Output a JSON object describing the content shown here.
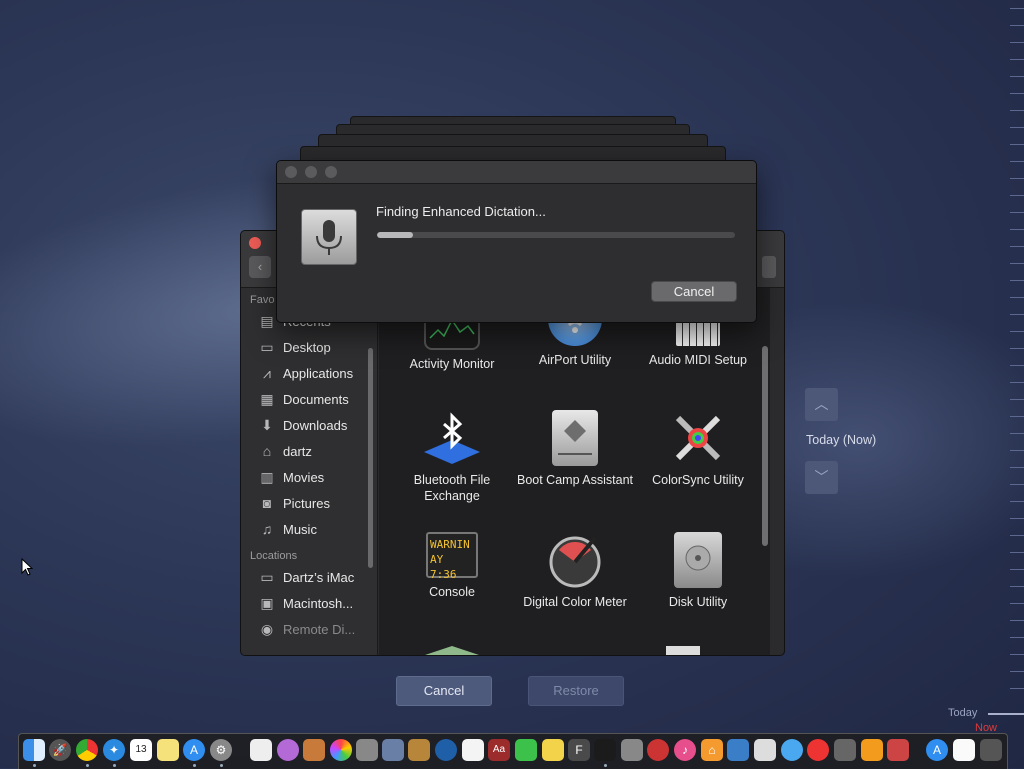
{
  "dialog": {
    "title": "Finding Enhanced Dictation...",
    "progress": 0.1,
    "cancel_label": "Cancel"
  },
  "finder": {
    "sidebar": {
      "favorites_heading": "Favo",
      "favorites": [
        {
          "label": "Recents",
          "icon": "recents-icon"
        },
        {
          "label": "Desktop",
          "icon": "desktop-icon"
        },
        {
          "label": "Applications",
          "icon": "applications-icon"
        },
        {
          "label": "Documents",
          "icon": "documents-icon"
        },
        {
          "label": "Downloads",
          "icon": "downloads-icon"
        },
        {
          "label": "dartz",
          "icon": "home-icon"
        },
        {
          "label": "Movies",
          "icon": "movies-icon"
        },
        {
          "label": "Pictures",
          "icon": "pictures-icon"
        },
        {
          "label": "Music",
          "icon": "music-icon"
        }
      ],
      "locations_heading": "Locations",
      "locations": [
        {
          "label": "Dartz’s iMac",
          "icon": "imac-icon"
        },
        {
          "label": "Macintosh...",
          "icon": "disk-icon"
        },
        {
          "label": "Remote Di...",
          "icon": "remote-disc-icon"
        }
      ]
    },
    "apps": [
      {
        "label": "Activity Monitor",
        "icon": "activity-monitor-icon"
      },
      {
        "label": "AirPort Utility",
        "icon": "airport-utility-icon"
      },
      {
        "label": "Audio MIDI Setup",
        "icon": "audio-midi-icon"
      },
      {
        "label": "Bluetooth File Exchange",
        "icon": "bluetooth-icon"
      },
      {
        "label": "Boot Camp Assistant",
        "icon": "boot-camp-icon"
      },
      {
        "label": "ColorSync Utility",
        "icon": "colorsync-icon"
      },
      {
        "label": "Console",
        "icon": "console-icon"
      },
      {
        "label": "Digital Color Meter",
        "icon": "color-meter-icon"
      },
      {
        "label": "Disk Utility",
        "icon": "disk-utility-icon"
      }
    ],
    "console_icon_text": [
      "WARNIN",
      "AY 7:36"
    ]
  },
  "time_machine": {
    "current_label": "Today (Now)",
    "cancel_label": "Cancel",
    "restore_label": "Restore",
    "timeline_today": "Today",
    "timeline_now": "Now"
  },
  "dock": {
    "calendar_day": "13"
  }
}
